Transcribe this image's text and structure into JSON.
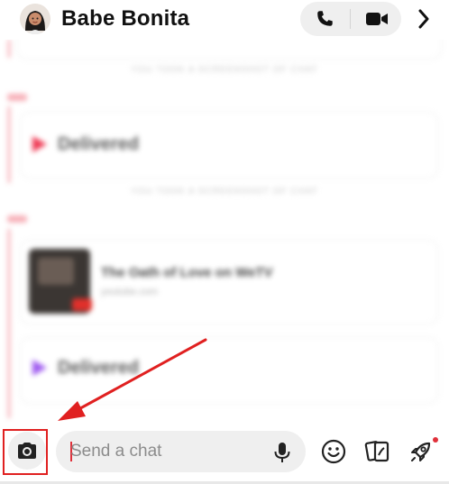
{
  "header": {
    "title": "Babe Bonita",
    "avatar_icon": "bitmoji-avatar-icon",
    "call_icon": "phone-icon",
    "video_icon": "video-camera-icon",
    "next_icon": "chevron-right-icon"
  },
  "chat": {
    "blurred": true,
    "system_messages": [
      "YOU TOOK A SCREENSHOT OF CHAT",
      "YOU TOOK A SCREENSHOT OF CHAT"
    ],
    "messages": [
      {
        "status": "Delivered",
        "icon": "sent-arrow-icon",
        "color": "#ef3b55"
      },
      {
        "link_title": "The Oath of Love on WeTV",
        "link_source": "youtube.com"
      },
      {
        "status": "Delivered",
        "icon": "sent-arrow-icon",
        "color": "#a05cf0"
      }
    ]
  },
  "composer": {
    "placeholder": "Send a chat",
    "camera_icon": "camera-icon",
    "mic_icon": "microphone-icon",
    "emoji_icon": "emoji-icon",
    "stickers_icon": "stickers-icon",
    "games_icon": "rocket-icon"
  },
  "annotation": {
    "highlight_color": "#e02020",
    "arrow_color": "#e02020"
  }
}
